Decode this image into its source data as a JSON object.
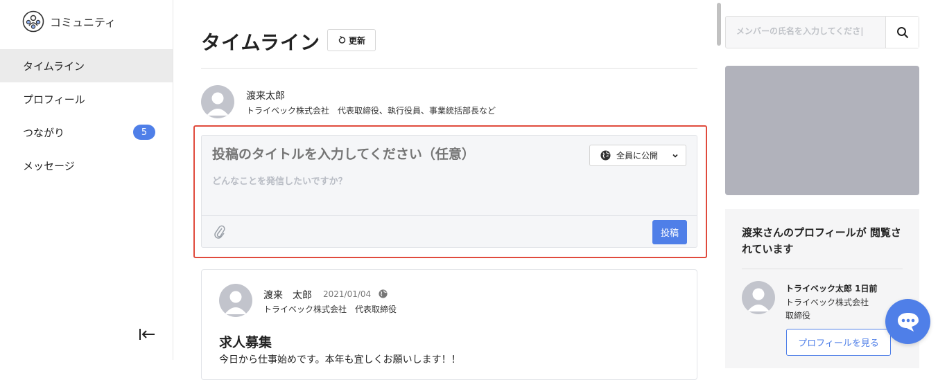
{
  "app": {
    "name": "コミュニティ"
  },
  "sidebar": {
    "items": [
      {
        "label": "タイムライン",
        "active": true
      },
      {
        "label": "プロフィール"
      },
      {
        "label": "つながり",
        "badge": "5"
      },
      {
        "label": "メッセージ"
      }
    ]
  },
  "page": {
    "title": "タイムライン",
    "refresh_label": "更新"
  },
  "me": {
    "name": "渡来太郎",
    "description": "トライベック株式会社　代表取締役、執行役員、事業統括部長など"
  },
  "composer": {
    "title_placeholder": "投稿のタイトルを入力してください（任意）",
    "body_placeholder": "どんなことを発信したいですか？",
    "visibility": "全員に公開",
    "submit_label": "投稿"
  },
  "post": {
    "author": "渡来　太郎",
    "date": "2021/01/04",
    "description": "トライベック株式会社　代表取締役",
    "title": "求人募集",
    "body": "今日から仕事始めです。本年も宜しくお願いします！！"
  },
  "search": {
    "placeholder": "メンバーの氏名を入力してくださ|"
  },
  "viewers": {
    "title": "渡来さんのプロフィールが 閲覧されています",
    "viewer_name": "トライベック太郎 1日前",
    "viewer_company": "トライベック株式会社",
    "viewer_role": "取締役",
    "button_label": "プロフィールを見る"
  },
  "colors": {
    "accent": "#4f7fe8",
    "highlight_border": "#e04a3c",
    "ad_placeholder": "#b1b2bb"
  }
}
